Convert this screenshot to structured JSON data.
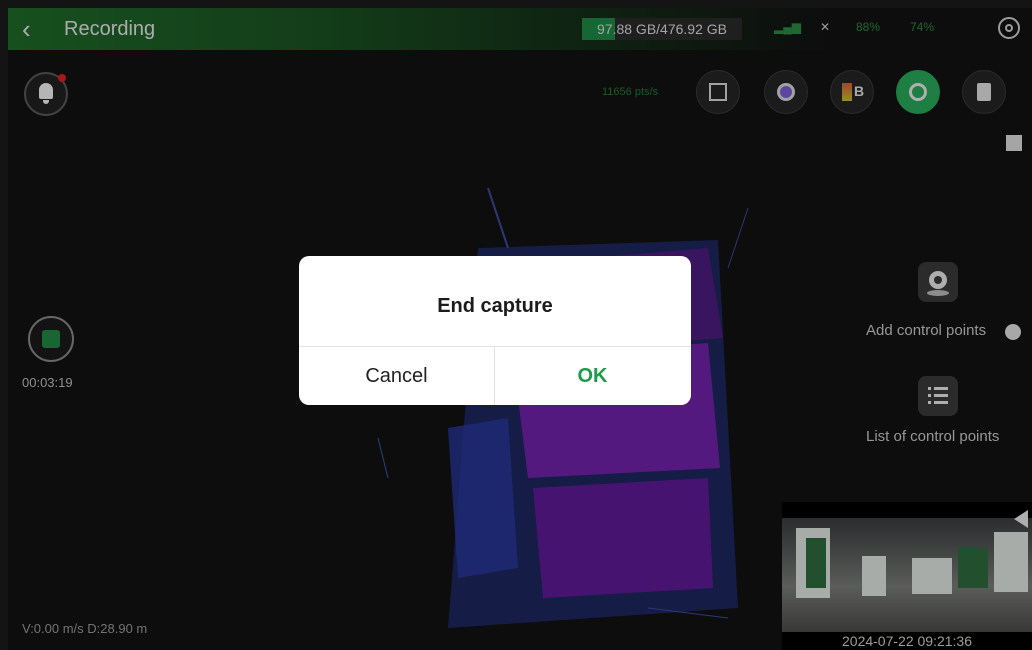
{
  "header": {
    "back_icon": "chevron-left-icon",
    "title": "Recording",
    "storage_text": "97.88 GB/476.92 GB",
    "storage_fraction": 0.205,
    "signal_icon": "signal-icon",
    "satellite_icon": "satellite-icon",
    "battery_1": "88%",
    "battery_2": "74%",
    "settings_icon": "settings-gear-icon"
  },
  "toolbar": {
    "point_count": "11656 pts/s",
    "tools": [
      "cube-view-icon",
      "eye-icon",
      "layer-color-icon",
      "target-icon",
      "trash-icon"
    ],
    "layer_letter": "B"
  },
  "recording": {
    "timer": "00:03:19",
    "speed": "V:0.00 m/s  D:28.90 m"
  },
  "side_panel": {
    "add_control_points": "Add control points",
    "list_control_points": "List of control points"
  },
  "thumbnail": {
    "timestamp": "2024-07-22 09:21:36"
  },
  "dialog": {
    "title": "End capture",
    "cancel": "Cancel",
    "ok": "OK"
  },
  "colors": {
    "accent_green": "#1e9a4a",
    "scan_purple": "#8a2be2",
    "scan_blue": "#2a3aa8"
  }
}
